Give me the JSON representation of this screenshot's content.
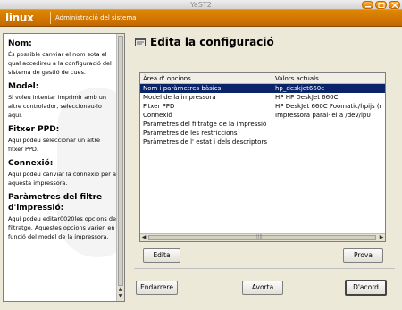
{
  "window": {
    "title": "YaST2"
  },
  "brand": {
    "logo": "linux",
    "header": "Administració del sistema"
  },
  "help": {
    "sections": [
      {
        "heading": "Nom:",
        "text": "És possible canviar el nom sota el qual accedireu a la configuració del sistema de gestió de cues."
      },
      {
        "heading": "Model:",
        "text": "Si voleu intentar imprimir amb un altre controlador, seleccioneu-lo aquí."
      },
      {
        "heading": "Fitxer PPD:",
        "text": "Aquí podeu seleccionar un altre fitxer PPD."
      },
      {
        "heading": "Connexió:",
        "text": "Aquí podeu canviar la connexió per a aquesta impressora."
      },
      {
        "heading": "Paràmetres del filtre d'impressió:",
        "text": "Aquí podeu editar0020les opcions de filtratge. Aquestes opcions varien en funció del model de la impressora."
      }
    ]
  },
  "main": {
    "title": "Edita la configuració",
    "table": {
      "headers": [
        "Àrea d' opcions",
        "Valors actuals"
      ],
      "rows": [
        {
          "option": "Nom i paràmetres bàsics",
          "value": "hp_deskjet660c",
          "selected": true
        },
        {
          "option": "Model de la impressora",
          "value": "HP HP DeskJet 660C",
          "selected": false
        },
        {
          "option": "Fitxer PPD",
          "value": "HP DeskJet 660C Foomatic/hpijs (r",
          "selected": false
        },
        {
          "option": "Connexió",
          "value": "Impressora paral·lel a /dev/lp0",
          "selected": false
        },
        {
          "option": "Paràmetres del filtratge de la impressió",
          "value": "",
          "selected": false
        },
        {
          "option": "Paràmetres de les restriccions",
          "value": "",
          "selected": false
        },
        {
          "option": "Paràmetres de l' estat i dels descriptors",
          "value": "",
          "selected": false
        }
      ]
    },
    "buttons": {
      "edit": "Edita",
      "test": "Prova",
      "back": "Endarrere",
      "abort": "Avorta",
      "ok": "D'acord"
    }
  },
  "colors": {
    "accent": "#d97a00",
    "selection": "#0a246a"
  }
}
